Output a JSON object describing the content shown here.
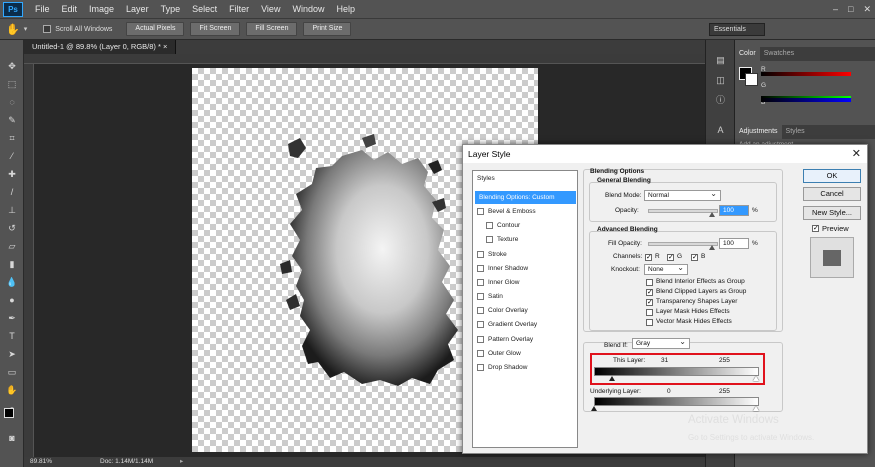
{
  "app": {
    "logo": "Ps"
  },
  "menu": [
    "File",
    "Edit",
    "Image",
    "Layer",
    "Type",
    "Select",
    "Filter",
    "View",
    "Window",
    "Help"
  ],
  "window_controls": [
    "–",
    "□",
    "✕"
  ],
  "options_bar": {
    "scroll_all_label": "Scroll All Windows",
    "actual_pixels": "Actual Pixels",
    "fit_screen": "Fit Screen",
    "fill_screen": "Fill Screen",
    "print_size": "Print Size",
    "workspace": "Essentials"
  },
  "doc_tab": "Untitled-1 @ 89.8% (Layer 0, RGB/8) * ×",
  "status": {
    "zoom": "89.81%",
    "doc": "Doc: 1.14M/1.14M"
  },
  "panels": {
    "color_tabs": [
      "Color",
      "Swatches"
    ],
    "channels": [
      "R",
      "G",
      "B"
    ],
    "adjust_tabs": [
      "Adjustments",
      "Styles"
    ],
    "adjust_hint": "Add an adjustment"
  },
  "dialog": {
    "title": "Layer Style",
    "close": "✕",
    "styles_header": "Styles",
    "styles": [
      {
        "label": "Blending Options: Custom",
        "checkbox": false,
        "selected": true,
        "indent": 0
      },
      {
        "label": "Bevel & Emboss",
        "checkbox": true,
        "selected": false,
        "indent": 0
      },
      {
        "label": "Contour",
        "checkbox": true,
        "selected": false,
        "indent": 1
      },
      {
        "label": "Texture",
        "checkbox": true,
        "selected": false,
        "indent": 1
      },
      {
        "label": "Stroke",
        "checkbox": true,
        "selected": false,
        "indent": 0
      },
      {
        "label": "Inner Shadow",
        "checkbox": true,
        "selected": false,
        "indent": 0
      },
      {
        "label": "Inner Glow",
        "checkbox": true,
        "selected": false,
        "indent": 0
      },
      {
        "label": "Satin",
        "checkbox": true,
        "selected": false,
        "indent": 0
      },
      {
        "label": "Color Overlay",
        "checkbox": true,
        "selected": false,
        "indent": 0
      },
      {
        "label": "Gradient Overlay",
        "checkbox": true,
        "selected": false,
        "indent": 0
      },
      {
        "label": "Pattern Overlay",
        "checkbox": true,
        "selected": false,
        "indent": 0
      },
      {
        "label": "Outer Glow",
        "checkbox": true,
        "selected": false,
        "indent": 0
      },
      {
        "label": "Drop Shadow",
        "checkbox": true,
        "selected": false,
        "indent": 0
      }
    ],
    "blending_options": "Blending Options",
    "general_blending": "General Blending",
    "blend_mode_label": "Blend Mode:",
    "blend_mode": "Normal",
    "opacity_label": "Opacity:",
    "opacity": "100",
    "pct": "%",
    "advanced_blending": "Advanced Blending",
    "fill_opacity_label": "Fill Opacity:",
    "fill_opacity": "100",
    "channels_label": "Channels:",
    "channel_r": "R",
    "channel_g": "G",
    "channel_b": "B",
    "knockout_label": "Knockout:",
    "knockout": "None",
    "options": [
      {
        "label": "Blend Interior Effects as Group",
        "checked": false
      },
      {
        "label": "Blend Clipped Layers as Group",
        "checked": true
      },
      {
        "label": "Transparency Shapes Layer",
        "checked": true
      },
      {
        "label": "Layer Mask Hides Effects",
        "checked": false
      },
      {
        "label": "Vector Mask Hides Effects",
        "checked": false
      }
    ],
    "blend_if_label": "Blend If:",
    "blend_if": "Gray",
    "this_layer_label": "This Layer:",
    "this_layer_low": "31",
    "this_layer_high": "255",
    "underlying_label": "Underlying Layer:",
    "underlying_low": "0",
    "underlying_high": "255",
    "ok": "OK",
    "cancel": "Cancel",
    "new_style": "New Style...",
    "preview": "Preview"
  },
  "watermark": {
    "line1": "Activate Windows",
    "line2": "Go to Settings to activate Windows."
  },
  "colors": {
    "highlight_red": "#e0121c",
    "selection_blue": "#3399ff"
  }
}
